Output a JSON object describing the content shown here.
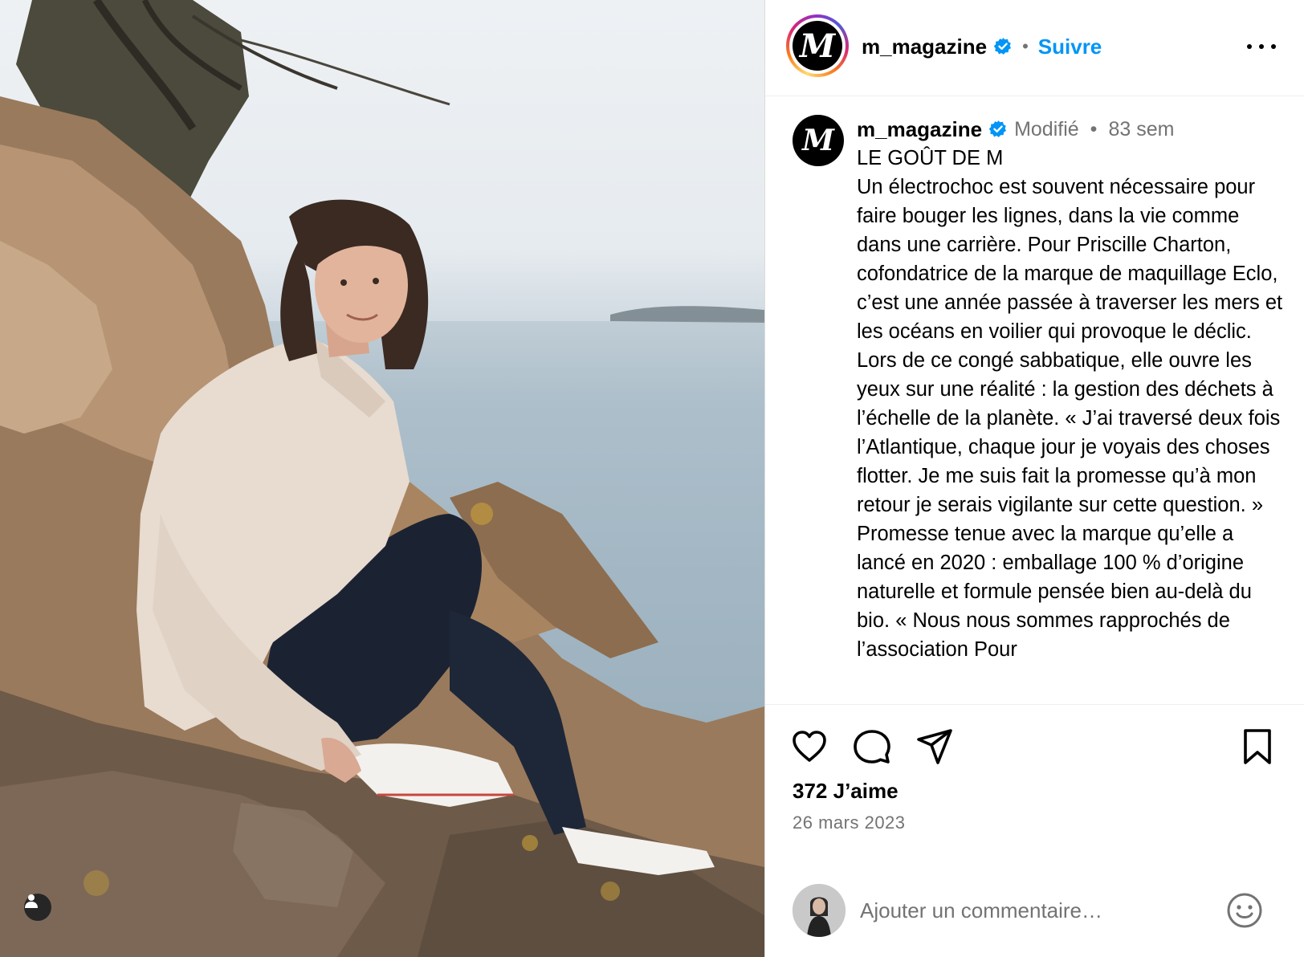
{
  "photo": {
    "description_icon": "person-tag-icon"
  },
  "header": {
    "username": "m_magazine",
    "logo_letter": "M",
    "separator": "•",
    "follow_label": "Suivre",
    "more_icon": "more-horizontal-icon"
  },
  "caption": {
    "username": "m_magazine",
    "edited_label": "Modifié",
    "separator": "•",
    "time_ago": "83 sem",
    "text": "LE GOÛT DE M\nUn électrochoc est souvent nécessaire pour faire bouger les lignes, dans la vie comme dans une carrière. Pour Priscille Charton, cofondatrice de la marque de maquillage Eclo, c’est une année passée à traverser les mers et les océans en voilier qui provoque le déclic. Lors de ce congé sabbatique, elle ouvre les yeux sur une réalité : la gestion des déchets à l’échelle de la planète. « J’ai traversé deux fois l’Atlantique, chaque jour je voyais des choses flotter. Je me suis fait la promesse qu’à mon retour je serais vigilante sur cette question. » Promesse tenue avec la marque qu’elle a lancé en 2020 : emballage 100 % d’origine naturelle et formule pensée bien au-delà du bio. « Nous nous sommes rapprochés de l’association Pour"
  },
  "actions": {
    "icons": [
      "heart-icon",
      "comment-icon",
      "share-icon",
      "bookmark-icon"
    ]
  },
  "likes": "372 J’aime",
  "date": "26 mars 2023",
  "comment": {
    "placeholder": "Ajouter un commentaire…",
    "emoji_icon": "emoji-icon"
  },
  "colors": {
    "accent": "#0095f6",
    "verified": "#0095f6",
    "muted": "#737373",
    "border": "#dbdbdb"
  }
}
